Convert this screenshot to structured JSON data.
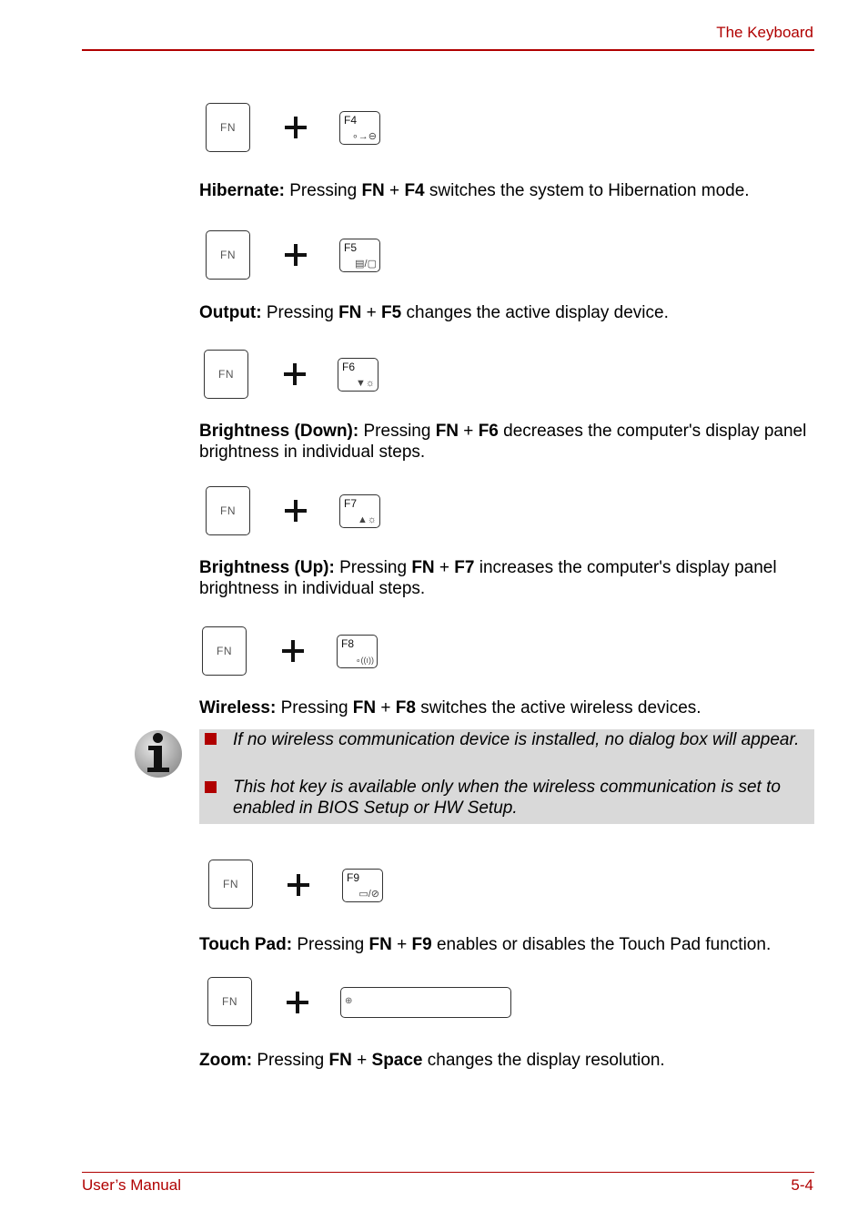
{
  "header": {
    "title": "The Keyboard"
  },
  "footer": {
    "left": "User’s Manual",
    "right": "5-4"
  },
  "keys": {
    "fn_label": "FN",
    "f4": {
      "label": "F4",
      "glyph": "∘→⊖",
      "icon": "hibernate-icon"
    },
    "f5": {
      "label": "F5",
      "glyph": "▤/▢",
      "icon": "display-output-icon"
    },
    "f6": {
      "label": "F6",
      "glyph": "▼☼",
      "icon": "brightness-down-icon"
    },
    "f7": {
      "label": "F7",
      "glyph": "▲☼",
      "icon": "brightness-up-icon"
    },
    "f8": {
      "label": "F8",
      "glyph": "∘((ı))",
      "icon": "wireless-icon"
    },
    "f9": {
      "label": "F9",
      "glyph": "▭/⊘",
      "icon": "touchpad-icon"
    },
    "space": {
      "label": "",
      "glyph": "⊕",
      "icon": "zoom-icon"
    }
  },
  "sections": [
    {
      "term": "Hibernate:",
      "pre": " Pressing ",
      "k1": "FN",
      "plus": " + ",
      "k2": "F4",
      "post": " switches the system to Hibernation mode."
    },
    {
      "term": "Output:",
      "pre": " Pressing ",
      "k1": "FN",
      "plus": " + ",
      "k2": "F5",
      "post": " changes the active display device."
    },
    {
      "term": "Brightness (Down):",
      "pre": " Pressing ",
      "k1": "FN",
      "plus": " + ",
      "k2": "F6",
      "post": " decreases the computer's display panel brightness in individual steps."
    },
    {
      "term": "Brightness (Up):",
      "pre": " Pressing ",
      "k1": "FN",
      "plus": " + ",
      "k2": "F7",
      "post": " increases the computer's display panel brightness in individual steps."
    },
    {
      "term": "Wireless:",
      "pre": " Pressing ",
      "k1": "FN",
      "plus": " + ",
      "k2": "F8",
      "post": " switches the active wireless devices."
    },
    {
      "term": "Touch Pad:",
      "pre": " Pressing ",
      "k1": "FN",
      "plus": " + ",
      "k2": "F9",
      "post": " enables or disables the Touch Pad function."
    },
    {
      "term": "Zoom:",
      "pre": " Pressing ",
      "k1": "FN",
      "plus": " + ",
      "k2": "Space",
      "post": " changes the display resolution."
    }
  ],
  "note": {
    "items": [
      "If no wireless communication device is installed, no dialog box will appear.",
      "This hot key is available only when the wireless communication is set to enabled in BIOS Setup or HW Setup."
    ]
  }
}
